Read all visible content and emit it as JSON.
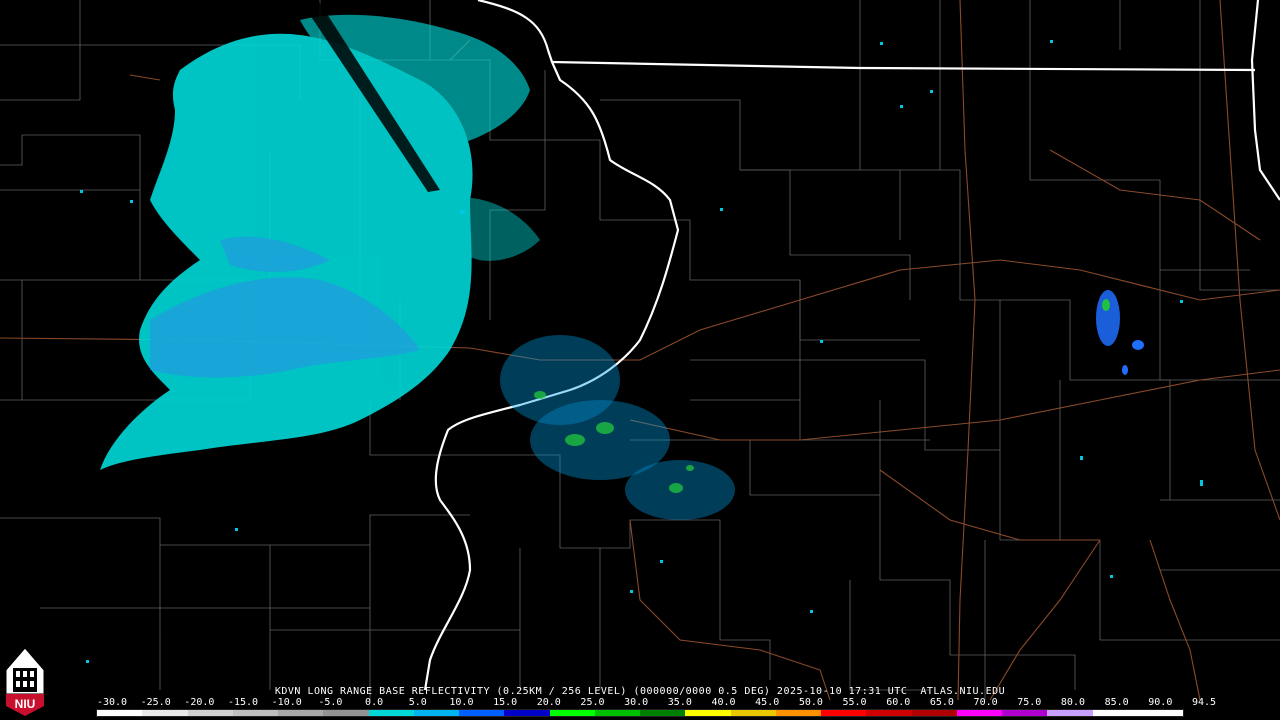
{
  "title": {
    "text": "KDVN LONG RANGE BASE REFLECTIVITY (0.25KM / 256 LEVEL) (000000/0000 0.5 DEG) 2025-10-10 17:31 UTC  ATLAS.NIU.EDU"
  },
  "scale": {
    "labels": [
      "-30.0",
      "-25.0",
      "-20.0",
      "-15.0",
      "-10.0",
      "-5.0",
      "0.0",
      "5.0",
      "10.0",
      "15.0",
      "20.0",
      "25.0",
      "30.0",
      "35.0",
      "40.0",
      "45.0",
      "50.0",
      "55.0",
      "60.0",
      "65.0",
      "70.0",
      "75.0",
      "80.0",
      "85.0",
      "90.0",
      "94.5"
    ],
    "colors": [
      "#ffffff",
      "#e8e8e8",
      "#cfcfcf",
      "#bfbfbf",
      "#a8a8a8",
      "#939393",
      "#00d8d8",
      "#00b4f0",
      "#0060ff",
      "#0000c8",
      "#00ff00",
      "#00c000",
      "#008000",
      "#ffff00",
      "#e8c800",
      "#ff9000",
      "#ff0000",
      "#d00000",
      "#b00000",
      "#ff00ff",
      "#b000d0",
      "#c8a0ff",
      "#ffffff",
      "#ffffff"
    ]
  },
  "logo": {
    "text": "NIU"
  }
}
